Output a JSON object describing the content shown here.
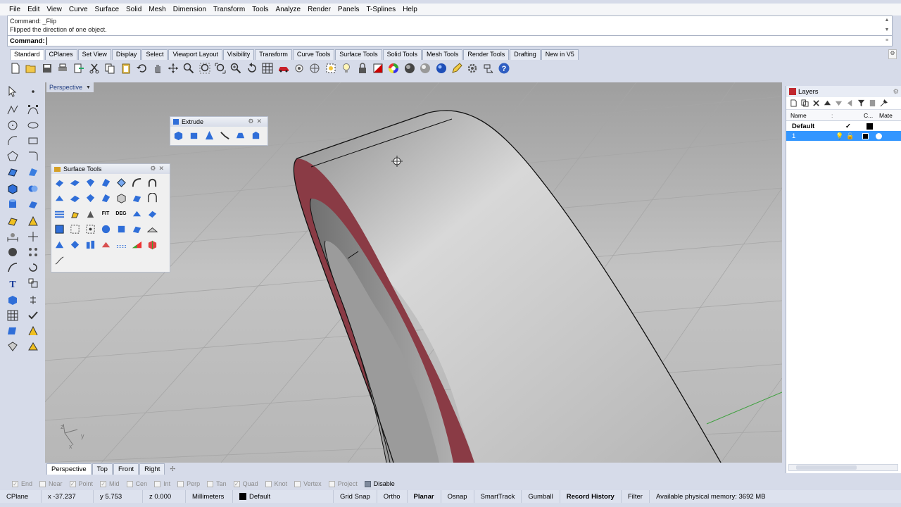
{
  "menu": [
    "File",
    "Edit",
    "View",
    "Curve",
    "Surface",
    "Solid",
    "Mesh",
    "Dimension",
    "Transform",
    "Tools",
    "Analyze",
    "Render",
    "Panels",
    "T-Splines",
    "Help"
  ],
  "command": {
    "history": [
      "Command: _Flip",
      "Flipped the direction of one object."
    ],
    "prompt_label": "Command:",
    "input_value": ""
  },
  "toolbar_tabs": [
    "Standard",
    "CPlanes",
    "Set View",
    "Display",
    "Select",
    "Viewport Layout",
    "Visibility",
    "Transform",
    "Curve Tools",
    "Surface Tools",
    "Solid Tools",
    "Mesh Tools",
    "Render Tools",
    "Drafting",
    "New in V5"
  ],
  "active_tab": "Standard",
  "toolbar_icons": [
    "new-file-icon",
    "open-folder-icon",
    "save-icon",
    "print-icon",
    "import-icon",
    "cut-icon",
    "copy-icon",
    "paste-icon",
    "undo-icon",
    "pan-hand-icon",
    "rotate-view-icon",
    "zoom-icon",
    "zoom-window-icon",
    "zoom-extents-icon",
    "zoom-selected-icon",
    "undo-view-icon",
    "grid-icon",
    "car-icon",
    "properties-icon",
    "osnap-icon",
    "ghosted-icon",
    "light-icon",
    "lock-icon",
    "shaded-icon",
    "color-wheel-icon",
    "rendered-sphere-icon",
    "material-sphere-icon",
    "blue-sphere-icon",
    "pen-icon",
    "options-gear-icon",
    "options-icon",
    "help-icon"
  ],
  "viewport": {
    "label": "Perspective",
    "axis_labels": {
      "z": "z",
      "y": "y",
      "x": "x"
    }
  },
  "palettes": {
    "extrude": {
      "title": "Extrude"
    },
    "surface_tools": {
      "title": "Surface Tools",
      "extra_labels": [
        "FIT",
        "DEG"
      ]
    }
  },
  "viewport_tabs": [
    "Perspective",
    "Top",
    "Front",
    "Right"
  ],
  "osnaps": [
    "End",
    "Near",
    "Point",
    "Mid",
    "Cen",
    "Int",
    "Perp",
    "Tan",
    "Quad",
    "Knot",
    "Vertex",
    "Project"
  ],
  "osnap_disable": "Disable",
  "status": {
    "cplane": "CPlane",
    "x": "x -37.237",
    "y": "y 5.753",
    "z": "z 0.000",
    "units": "Millimeters",
    "layer": "Default",
    "grid_snap": "Grid Snap",
    "ortho": "Ortho",
    "planar": "Planar",
    "osnap": "Osnap",
    "smarttrack": "SmartTrack",
    "gumball": "Gumball",
    "record_history": "Record History",
    "filter": "Filter",
    "memory": "Available physical memory: 3692 MB"
  },
  "layers": {
    "title": "Layers",
    "columns": {
      "name": "Name",
      "current": "C.",
      "color": "C...",
      "material": "Mate"
    },
    "rows": [
      {
        "name": "Default",
        "current": "✓",
        "color": "#000000"
      },
      {
        "name": "1",
        "current": "",
        "color": "#000000"
      }
    ]
  },
  "colors": {
    "accent_select": "#3396ff",
    "viewport_bg": "#b9b9b9",
    "object_rim": "#8a3b45"
  }
}
